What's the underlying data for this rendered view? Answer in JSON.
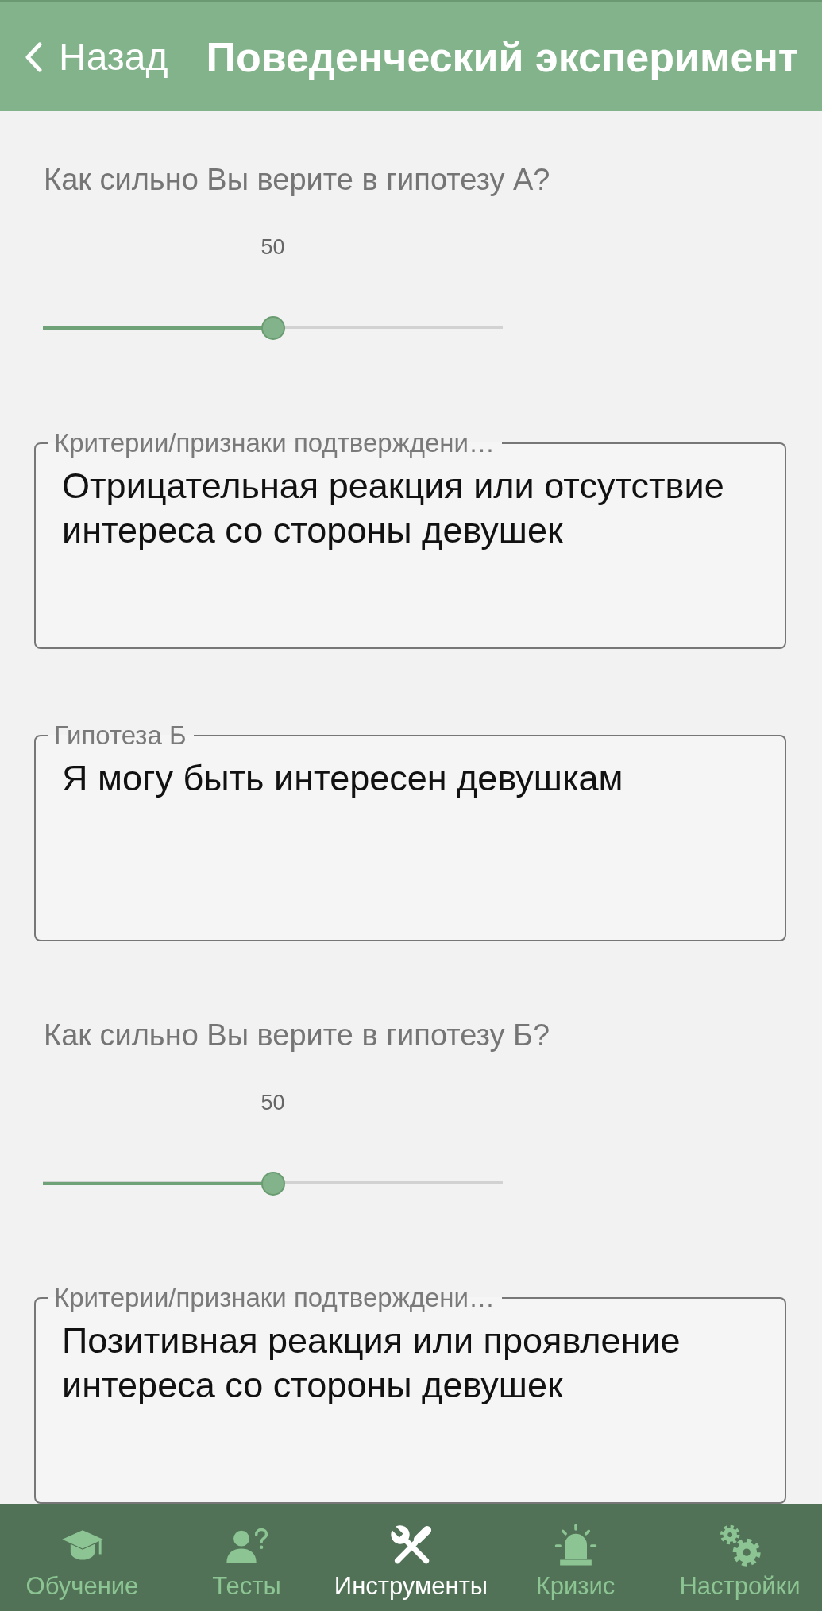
{
  "header": {
    "back_label": "Назад",
    "title": "Поведенческий эксперимент"
  },
  "content": [
    {
      "kind": "slider",
      "question": "Как сильно Вы верите в гипотезу А?",
      "reading": "50",
      "level": 0.5
    },
    {
      "kind": "field",
      "label": "Критерии/признаки подтверждени…",
      "value": "Отрицательная реакция или отсутствие интереса со стороны девушек"
    },
    {
      "kind": "divider"
    },
    {
      "kind": "field",
      "label": "Гипотеза Б",
      "value": "Я могу быть интересен девушкам"
    },
    {
      "kind": "slider",
      "question": "Как сильно Вы верите в гипотезу Б?",
      "reading": "50",
      "level": 0.5
    },
    {
      "kind": "field",
      "label": "Критерии/признаки подтверждени…",
      "value": "Позитивная реакция или проявление интереса со стороны девушек"
    }
  ],
  "bottom_nav": [
    {
      "kind": "learn",
      "label": "Обучение",
      "selected": false
    },
    {
      "kind": "tests",
      "label": "Тесты",
      "selected": false
    },
    {
      "kind": "tools",
      "label": "Инструменты",
      "selected": true
    },
    {
      "kind": "crisis",
      "label": "Кризис",
      "selected": false
    },
    {
      "kind": "settings",
      "label": "Настройки",
      "selected": false
    }
  ]
}
